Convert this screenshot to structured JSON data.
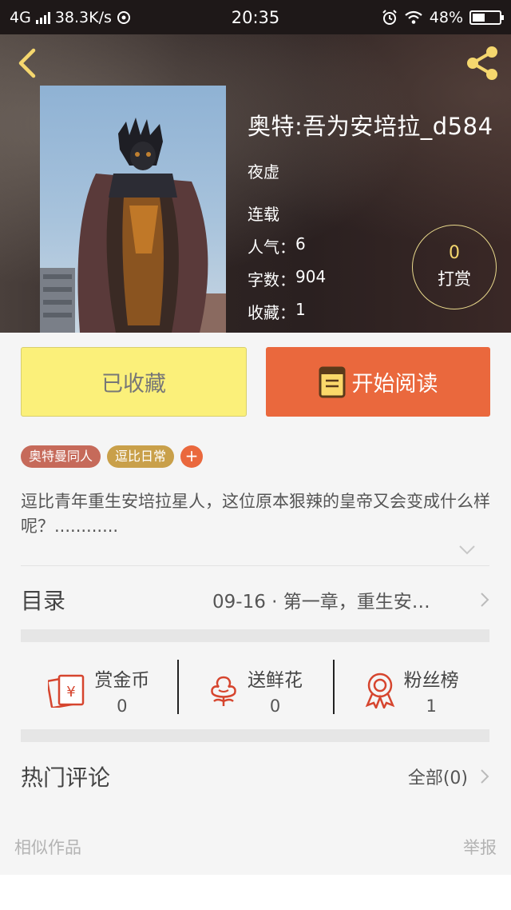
{
  "status_bar": {
    "network": "4G",
    "speed": "38.3K/s",
    "time": "20:35",
    "battery": "48%",
    "battery_level": 0.48
  },
  "book": {
    "title": "奥特:吾为安培拉_d584",
    "author": "夜虚",
    "status": "连载",
    "popularity_label": "人气：",
    "popularity": "6",
    "words_label": "字数：",
    "words": "904",
    "favorites_label": "收藏：",
    "favorites": "1"
  },
  "reward": {
    "count": "0",
    "label": "打赏"
  },
  "actions": {
    "collect_label": "已收藏",
    "read_label": "开始阅读"
  },
  "tags": [
    {
      "label": "奥特曼同人",
      "color": "#c66a5a"
    },
    {
      "label": "逗比日常",
      "color": "#c9a04a"
    }
  ],
  "tag_add": "+",
  "description": "逗比青年重生安培拉星人，这位原本狠辣的皇帝又会变成什么样呢？............",
  "toc": {
    "label": "目录",
    "latest": "09-16 · 第一章，重生安…"
  },
  "stats": [
    {
      "label": "赏金币",
      "value": "0",
      "icon": "gold-coin-icon"
    },
    {
      "label": "送鲜花",
      "value": "0",
      "icon": "flower-icon"
    },
    {
      "label": "粉丝榜",
      "value": "1",
      "icon": "medal-icon"
    }
  ],
  "comments": {
    "title": "热门评论",
    "all_label": "全部(0)"
  },
  "footer": {
    "similar_label": "相似作品",
    "report_label": "举报"
  },
  "colors": {
    "accent": "#ea683d",
    "collect_bg": "#fbf07a",
    "icon_red": "#d6452e",
    "gold": "#f5d76e"
  }
}
